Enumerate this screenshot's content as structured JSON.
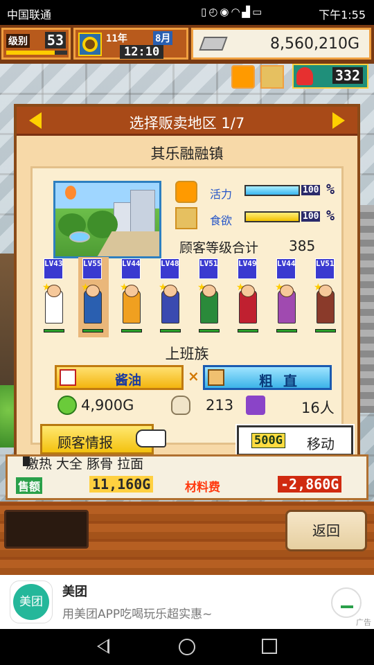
{
  "status_bar": {
    "carrier": "中国联通",
    "time": "下午1:55"
  },
  "hud": {
    "level_label": "级别",
    "level": "53",
    "year": "11年",
    "month": "8月",
    "clock": "12:10",
    "money": "8,560,210G",
    "pin_count": "332"
  },
  "dialog": {
    "title": "选择贩卖地区 1/7",
    "district": "其乐融融镇",
    "stats": {
      "vitality_label": "活力",
      "vitality_pct": "100",
      "appetite_label": "食欲",
      "appetite_pct": "100",
      "pct_symbol": "%"
    },
    "total_label": "顾客等级合计",
    "total_value": "385",
    "customers": [
      {
        "lv": "LV43",
        "color": "#ffffff"
      },
      {
        "lv": "LV55",
        "color": "#2a5fb0"
      },
      {
        "lv": "LV44",
        "color": "#f0a020"
      },
      {
        "lv": "LV48",
        "color": "#3a4ab0"
      },
      {
        "lv": "LV51",
        "color": "#2a8a3a"
      },
      {
        "lv": "LV49",
        "color": "#c02030"
      },
      {
        "lv": "LV44",
        "color": "#a04ab0"
      },
      {
        "lv": "LV51",
        "color": "#8a3a2a"
      }
    ],
    "customer_type": "上班族",
    "pref_left": "酱油",
    "pref_x": "×",
    "pref_right": "粗 直",
    "price": "4,900G",
    "spoon_value": "213",
    "people": "16人"
  },
  "buttons": {
    "customer_info": "顾客情报",
    "move_cost": "500G",
    "move_label": "移动",
    "back": "返回"
  },
  "panel": {
    "dish": "激热 大全 豚骨 拉面",
    "sales_label": "售额",
    "sales_value": "11,160G",
    "material_label": "材料费",
    "material_value": "-2,860G"
  },
  "ad": {
    "logo_text": "美团",
    "brand": "美团",
    "desc": "用美团APP吃喝玩乐超实惠~",
    "tag": "广告"
  },
  "icons": [
    "cloud-icon",
    "vibrate-icon",
    "alarm-icon",
    "eye-icon",
    "wifi-icon",
    "signal-icon",
    "battery-icon",
    "sunflower-icon",
    "cash-icon",
    "smiley-icon",
    "fork-knife-icon",
    "pin-icon",
    "soy-bottle-icon",
    "noodle-icon",
    "money-bag-icon",
    "spoon-icon",
    "ghost-icon",
    "hand-pointer-icon",
    "download-icon"
  ],
  "colors": {
    "dialog_header": "#a84a18",
    "dialog_bg": "#f7d9a8",
    "accent_yellow": "#ffd000",
    "accent_blue": "#3cb4e8"
  }
}
